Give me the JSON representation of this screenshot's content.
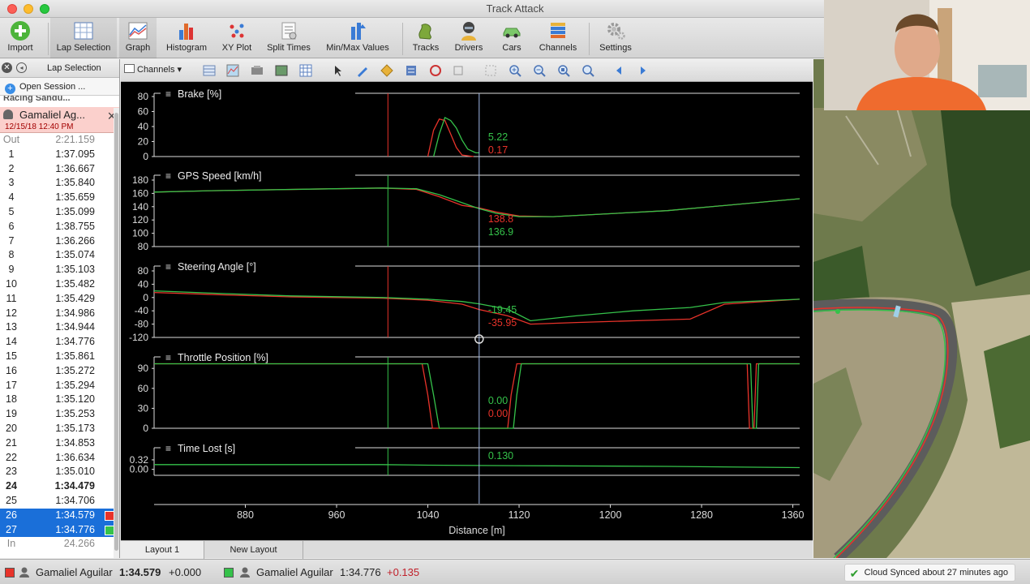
{
  "window": {
    "title": "Track Attack"
  },
  "toolbar": {
    "items": [
      {
        "label": "Import",
        "icon": "import-icon"
      },
      {
        "label": "Lap Selection",
        "icon": "lap-selection-icon"
      },
      {
        "label": "Graph",
        "icon": "graph-icon"
      },
      {
        "label": "Histogram",
        "icon": "histogram-icon"
      },
      {
        "label": "XY Plot",
        "icon": "xy-plot-icon"
      },
      {
        "label": "Split Times",
        "icon": "split-times-icon"
      },
      {
        "label": "Min/Max Values",
        "icon": "min-max-icon"
      },
      {
        "label": "Tracks",
        "icon": "tracks-icon"
      },
      {
        "label": "Drivers",
        "icon": "drivers-icon"
      },
      {
        "label": "Cars",
        "icon": "cars-icon"
      },
      {
        "label": "Channels",
        "icon": "channels-icon"
      },
      {
        "label": "Settings",
        "icon": "gear-icon"
      }
    ]
  },
  "sidebar": {
    "header": "Lap Selection",
    "open_session": "Open Session ...",
    "session_cut": "Racing Sandu...",
    "session": {
      "driver": "Gamaliel Ag...",
      "date": "12/15/18 12:40 PM"
    },
    "laps": [
      {
        "n": "Out",
        "t": "2:21.159",
        "style": "dim"
      },
      {
        "n": "1",
        "t": "1:37.095"
      },
      {
        "n": "2",
        "t": "1:36.667"
      },
      {
        "n": "3",
        "t": "1:35.840"
      },
      {
        "n": "4",
        "t": "1:35.659"
      },
      {
        "n": "5",
        "t": "1:35.099"
      },
      {
        "n": "6",
        "t": "1:38.755"
      },
      {
        "n": "7",
        "t": "1:36.266"
      },
      {
        "n": "8",
        "t": "1:35.074"
      },
      {
        "n": "9",
        "t": "1:35.103"
      },
      {
        "n": "10",
        "t": "1:35.482"
      },
      {
        "n": "11",
        "t": "1:35.429"
      },
      {
        "n": "12",
        "t": "1:34.986"
      },
      {
        "n": "13",
        "t": "1:34.944"
      },
      {
        "n": "14",
        "t": "1:34.776"
      },
      {
        "n": "15",
        "t": "1:35.861"
      },
      {
        "n": "16",
        "t": "1:35.272"
      },
      {
        "n": "17",
        "t": "1:35.294"
      },
      {
        "n": "18",
        "t": "1:35.120"
      },
      {
        "n": "19",
        "t": "1:35.253"
      },
      {
        "n": "20",
        "t": "1:35.173"
      },
      {
        "n": "21",
        "t": "1:34.853"
      },
      {
        "n": "22",
        "t": "1:36.634"
      },
      {
        "n": "23",
        "t": "1:35.010"
      },
      {
        "n": "24",
        "t": "1:34.479",
        "style": "best"
      },
      {
        "n": "25",
        "t": "1:34.706"
      },
      {
        "n": "26",
        "t": "1:34.579",
        "style": "sel",
        "swatch": "#e8332a"
      },
      {
        "n": "27",
        "t": "1:34.776",
        "style": "sel",
        "swatch": "#35c24a"
      },
      {
        "n": "In",
        "t": "24.266",
        "style": "dim"
      }
    ]
  },
  "chart_toolbar": {
    "channels_label": "Channels"
  },
  "tabs": [
    "Layout 1",
    "New Layout"
  ],
  "colors": {
    "lap_a": "#e8332a",
    "lap_b": "#35c24a",
    "cursor": "#9fb8e8"
  },
  "chart_data": [
    {
      "type": "line",
      "title": "Brake [%]",
      "ylim": [
        0,
        80
      ],
      "yticks": [
        0,
        20,
        40,
        60,
        80
      ],
      "cursor_values": [
        {
          "color": "green",
          "value": "5.22"
        },
        {
          "color": "red",
          "value": "0.17"
        }
      ],
      "series": [
        {
          "color": "red",
          "points": [
            [
              1040,
              0
            ],
            [
              1045,
              35
            ],
            [
              1050,
              50
            ],
            [
              1055,
              48
            ],
            [
              1060,
              30
            ],
            [
              1065,
              12
            ],
            [
              1070,
              2
            ],
            [
              1080,
              0
            ]
          ]
        },
        {
          "color": "green",
          "points": [
            [
              1045,
              0
            ],
            [
              1050,
              30
            ],
            [
              1055,
              52
            ],
            [
              1060,
              48
            ],
            [
              1065,
              38
            ],
            [
              1070,
              22
            ],
            [
              1075,
              10
            ],
            [
              1082,
              5
            ],
            [
              1085,
              5
            ]
          ]
        }
      ]
    },
    {
      "type": "line",
      "title": "GPS Speed [km/h]",
      "ylim": [
        80,
        180
      ],
      "yticks": [
        80,
        100,
        120,
        140,
        160,
        180
      ],
      "cursor_values": [
        {
          "color": "red",
          "value": "138.8"
        },
        {
          "color": "green",
          "value": "136.9"
        }
      ],
      "series": [
        {
          "color": "red",
          "points": [
            [
              800,
              162
            ],
            [
              850,
              164
            ],
            [
              1000,
              168
            ],
            [
              1030,
              166
            ],
            [
              1050,
              155
            ],
            [
              1070,
              142
            ],
            [
              1085,
              138
            ],
            [
              1100,
              132
            ],
            [
              1120,
              126
            ],
            [
              1150,
              125
            ],
            [
              1250,
              134
            ],
            [
              1366,
              152
            ]
          ]
        },
        {
          "color": "green",
          "points": [
            [
              800,
              162
            ],
            [
              850,
              164
            ],
            [
              1000,
              168
            ],
            [
              1030,
              167
            ],
            [
              1050,
              158
            ],
            [
              1070,
              146
            ],
            [
              1085,
              137
            ],
            [
              1100,
              130
            ],
            [
              1120,
              125
            ],
            [
              1150,
              125
            ],
            [
              1250,
              134
            ],
            [
              1366,
              152
            ]
          ]
        }
      ]
    },
    {
      "type": "line",
      "title": "Steering Angle [°]",
      "ylim": [
        -120,
        80
      ],
      "yticks": [
        -120,
        -80,
        -40,
        0,
        40,
        80
      ],
      "cursor_values": [
        {
          "color": "green",
          "value": "-19.45"
        },
        {
          "color": "red",
          "value": "-35.95"
        }
      ],
      "series": [
        {
          "color": "red",
          "points": [
            [
              800,
              15
            ],
            [
              860,
              8
            ],
            [
              920,
              2
            ],
            [
              1000,
              -2
            ],
            [
              1040,
              -8
            ],
            [
              1070,
              -20
            ],
            [
              1085,
              -36
            ],
            [
              1110,
              -55
            ],
            [
              1130,
              -80
            ],
            [
              1170,
              -75
            ],
            [
              1220,
              -70
            ],
            [
              1270,
              -65
            ],
            [
              1300,
              -20
            ],
            [
              1366,
              -5
            ]
          ]
        },
        {
          "color": "green",
          "points": [
            [
              800,
              20
            ],
            [
              860,
              12
            ],
            [
              920,
              5
            ],
            [
              1000,
              0
            ],
            [
              1040,
              -5
            ],
            [
              1070,
              -12
            ],
            [
              1085,
              -19
            ],
            [
              1110,
              -35
            ],
            [
              1130,
              -70
            ],
            [
              1170,
              -55
            ],
            [
              1220,
              -40
            ],
            [
              1270,
              -30
            ],
            [
              1300,
              -15
            ],
            [
              1366,
              -5
            ]
          ]
        }
      ]
    },
    {
      "type": "line",
      "title": "Throttle Position [%]",
      "ylim": [
        0,
        100
      ],
      "yticks": [
        0,
        30,
        60,
        90
      ],
      "cursor_values": [
        {
          "color": "green",
          "value": "0.00"
        },
        {
          "color": "red",
          "value": "0.00"
        }
      ],
      "series": [
        {
          "color": "red",
          "points": [
            [
              800,
              97
            ],
            [
              1035,
              97
            ],
            [
              1040,
              50
            ],
            [
              1044,
              0
            ],
            [
              1110,
              0
            ],
            [
              1113,
              50
            ],
            [
              1118,
              97
            ],
            [
              1320,
              97
            ],
            [
              1322,
              0
            ],
            [
              1326,
              0
            ],
            [
              1328,
              97
            ],
            [
              1366,
              97
            ]
          ]
        },
        {
          "color": "green",
          "points": [
            [
              800,
              97
            ],
            [
              1040,
              97
            ],
            [
              1045,
              50
            ],
            [
              1050,
              0
            ],
            [
              1115,
              0
            ],
            [
              1118,
              50
            ],
            [
              1122,
              97
            ],
            [
              1323,
              97
            ],
            [
              1325,
              0
            ],
            [
              1328,
              0
            ],
            [
              1330,
              97
            ],
            [
              1366,
              97
            ]
          ]
        }
      ]
    },
    {
      "type": "line",
      "title": "Time Lost [s]",
      "ylim": [
        -0.2,
        0.4
      ],
      "yticks_labels": [
        "0.00",
        "0.32"
      ],
      "yticks": [
        0,
        0.32
      ],
      "cursor_values": [
        {
          "color": "green",
          "value": "0.130"
        }
      ],
      "series": [
        {
          "color": "green",
          "points": [
            [
              800,
              0.16
            ],
            [
              1000,
              0.16
            ],
            [
              1040,
              0.14
            ],
            [
              1085,
              0.13
            ],
            [
              1150,
              0.12
            ],
            [
              1250,
              0.1
            ],
            [
              1366,
              0.06
            ]
          ]
        }
      ]
    }
  ],
  "x_axis": {
    "label": "Distance [m]",
    "ticks": [
      880,
      960,
      1040,
      1120,
      1200,
      1280,
      1360
    ],
    "range": [
      800,
      1366
    ],
    "cursor": 1085,
    "marker": 1005
  },
  "status": {
    "lap_a": {
      "driver": "Gamaliel Aguilar",
      "time": "1:34.579",
      "delta": "+0.000"
    },
    "lap_b": {
      "driver": "Gamaliel Aguilar",
      "time": "1:34.776",
      "delta": "+0.135"
    },
    "cloud": "Cloud Synced about 27 minutes ago"
  }
}
